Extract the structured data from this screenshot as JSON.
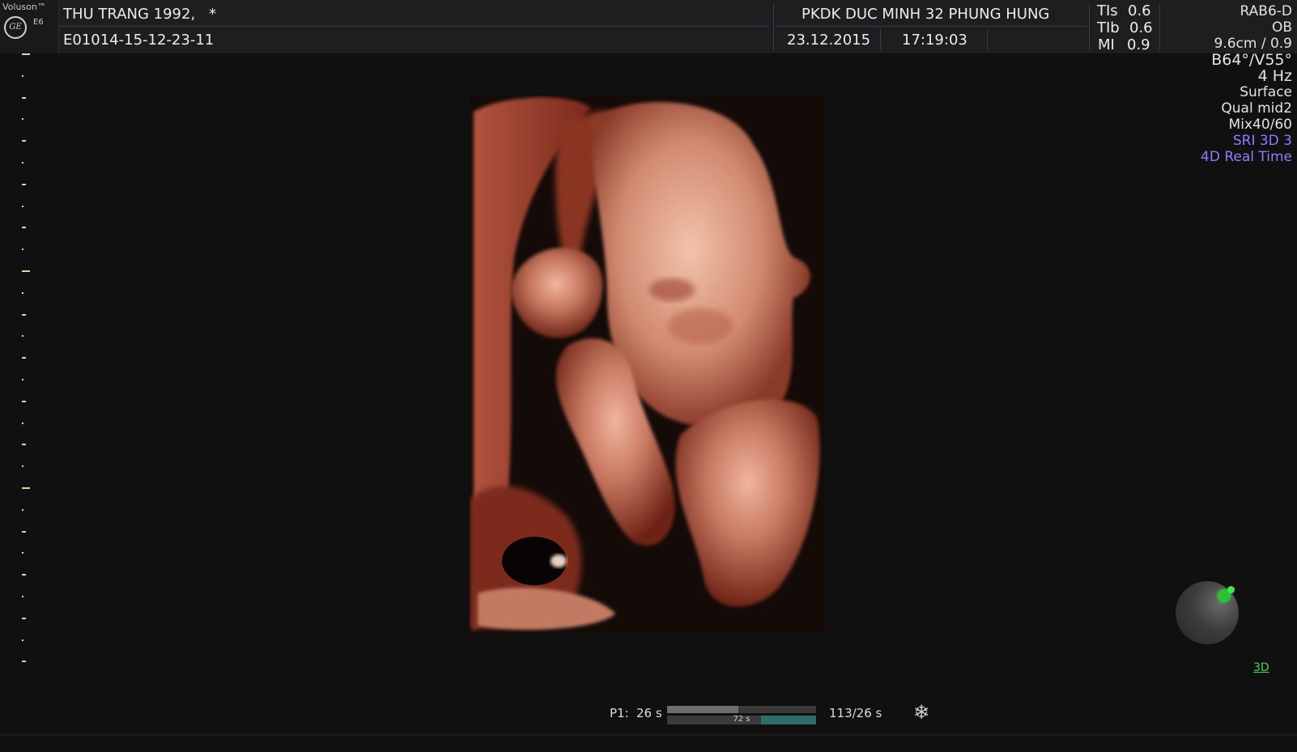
{
  "header": {
    "brand": "Voluson™",
    "model": "E6",
    "ge_logo_text": "GE",
    "patient_name": "THU TRANG 1992,",
    "patient_flag": "*",
    "exam_id": "E01014-15-12-23-11",
    "institution": "PKDK DUC MINH 32 PHUNG HUNG",
    "date": "23.12.2015",
    "time": "17:19:03",
    "safety": [
      {
        "label": "TIs",
        "value": "0.6"
      },
      {
        "label": "TIb",
        "value": "0.6"
      },
      {
        "label": "MI",
        "value": "0.9"
      }
    ]
  },
  "params": {
    "probe": "RAB6-D",
    "app": "OB",
    "depth": "9.6cm / 0.9",
    "angles": "B64°/V55°",
    "rate": "4 Hz",
    "render_mode": "Surface",
    "quality": "Qual mid2",
    "mix": "Mix40/60",
    "sri": "SRI 3D 3",
    "mode": "4D Real Time"
  },
  "status": {
    "p1_label": "P1:",
    "p1_value": "26 s",
    "buffer_top_fraction": 0.48,
    "buffer_bottom_fraction": 0.37,
    "buffer_label": "72 s",
    "cine_count": "113/26 s",
    "freeze_icon": "snowflake-icon"
  },
  "orientation": {
    "mode_label": "3D",
    "marker_color": "#29c233"
  }
}
